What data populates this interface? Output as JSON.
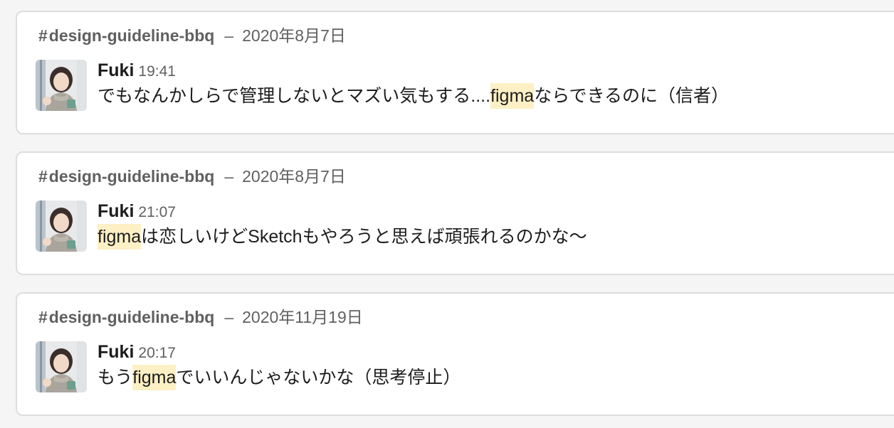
{
  "search_results": [
    {
      "channel_prefix": "#",
      "channel": "design-guideline-bbq",
      "separator": "–",
      "date": "2020年8月7日",
      "sender": "Fuki",
      "time": "19:41",
      "message_before": "でもなんかしらで管理しないとマズい気もする....",
      "highlight": "figma",
      "message_after": "ならできるのに（信者）"
    },
    {
      "channel_prefix": "#",
      "channel": "design-guideline-bbq",
      "separator": "–",
      "date": "2020年8月7日",
      "sender": "Fuki",
      "time": "21:07",
      "message_before": "",
      "highlight": "figma",
      "message_after": "は恋しいけどSketchもやろうと思えば頑張れるのかな〜"
    },
    {
      "channel_prefix": "#",
      "channel": "design-guideline-bbq",
      "separator": "–",
      "date": "2020年11月19日",
      "sender": "Fuki",
      "time": "20:17",
      "message_before": "もう",
      "highlight": "figma",
      "message_after": "でいいんじゃないかな（思考停止）"
    }
  ],
  "colors": {
    "highlight": "#fdf0c4",
    "card_border": "#dddddd",
    "muted_text": "#616061",
    "text": "#1d1c1d",
    "background": "#f5f5f5"
  },
  "icons": {
    "avatar": "user-avatar-photo"
  }
}
